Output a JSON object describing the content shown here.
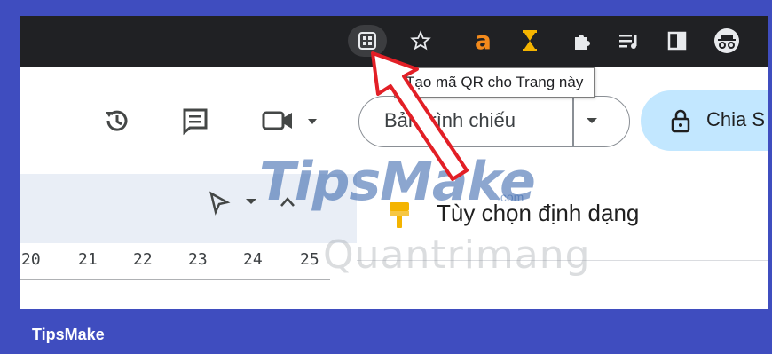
{
  "tooltip": {
    "text": "Tạo mã QR cho Trang này"
  },
  "toolbar": {
    "slideshow_label": "Bản trình chiếu",
    "share_label": "Chia S"
  },
  "format_options": {
    "label": "Tùy chọn định dạng"
  },
  "ruler": {
    "numbers": [
      "20",
      "21",
      "22",
      "23",
      "24",
      "25"
    ]
  },
  "watermark": {
    "brand": "TipsMake",
    "brand_suffix": ".com",
    "secondary": "Quantrimang"
  },
  "footer": {
    "brand": "TipsMake"
  },
  "colors": {
    "frame_bg": "#3f4dbf",
    "topbar": "#202124",
    "share_button": "#c2e7ff",
    "arrow": "#e21f26"
  }
}
